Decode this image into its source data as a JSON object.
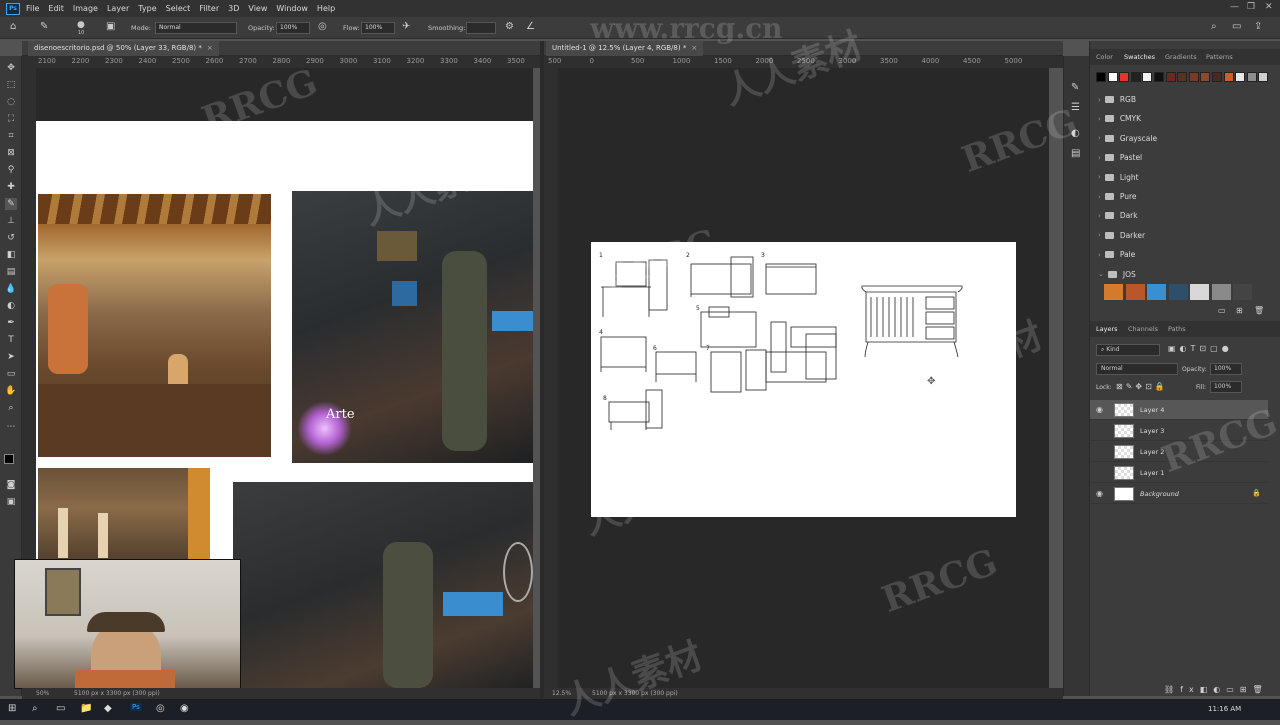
{
  "menu": [
    "File",
    "Edit",
    "Image",
    "Layer",
    "Type",
    "Select",
    "Filter",
    "3D",
    "View",
    "Window",
    "Help"
  ],
  "app_badge": "Ps",
  "options": {
    "mode_label": "Mode:",
    "mode_value": "Normal",
    "opacity_label": "Opacity:",
    "opacity_value": "100%",
    "flow_label": "Flow:",
    "flow_value": "100%",
    "smoothing_label": "Smoothing:",
    "brush_size": "10"
  },
  "doc_left": {
    "tab": "disenoescritorio.psd @ 50% (Layer 33, RGB/8) *",
    "zoom": "50%",
    "info": "5100 px x 3300 px (300 ppi)",
    "ruler": [
      "2100",
      "2200",
      "2300",
      "2400",
      "2500",
      "2600",
      "2700",
      "2800",
      "2900",
      "3000",
      "3100",
      "3200",
      "3300",
      "3400",
      "3500"
    ],
    "overlay_text": "Arte"
  },
  "doc_right": {
    "tab": "Untitled-1 @ 12.5% (Layer 4, RGB/8) *",
    "zoom": "12.5%",
    "info": "5100 px x 3300 px (300 ppi)",
    "ruler": [
      "500",
      "0",
      "500",
      "1000",
      "1500",
      "2000",
      "2500",
      "3000",
      "3500",
      "4000",
      "4500",
      "5000"
    ],
    "sketch_marks": [
      "1",
      "2",
      "3",
      "4",
      "5",
      "6",
      "7",
      "8"
    ]
  },
  "swatch_tabs": [
    "Color",
    "Swatches",
    "Gradients",
    "Patterns"
  ],
  "swatch_colors": [
    "#000000",
    "#ffffff",
    "#e03a2f",
    "#222222",
    "#f5f5f5",
    "#111111",
    "#6a2b1e",
    "#5a3020",
    "#7a3a28",
    "#8a4a30",
    "#4a2a20",
    "#c8622a",
    "#e8e8e8",
    "#8c8c8c",
    "#cfcfcf"
  ],
  "swatch_groups": [
    "RGB",
    "CMYK",
    "Grayscale",
    "Pastel",
    "Light",
    "Pure",
    "Dark",
    "Darker",
    "Pale",
    "JOS"
  ],
  "jos_colors": [
    "#d37a2c",
    "#b9572a",
    "#3a8fd0",
    "#2e4f6a",
    "#d8d8d8",
    "#8a8a8a",
    "#444444"
  ],
  "layer_tabs": [
    "Layers",
    "Channels",
    "Paths"
  ],
  "layers_controls": {
    "kind": "Kind",
    "blend": "Normal",
    "opacity_label": "Opacity:",
    "opacity_value": "100%",
    "lock_label": "Lock:",
    "fill_label": "Fill:",
    "fill_value": "100%"
  },
  "layers": [
    "Layer 4",
    "Layer 3",
    "Layer 2",
    "Layer 1",
    "Background"
  ],
  "taskbar": {
    "time": "11:16 AM"
  },
  "watermarks": [
    "www.rrcg.cn",
    "RRCG",
    "人人素材",
    "RRCG",
    "人人素材",
    "RRCG",
    "人人素材",
    "RRCG",
    "人人素材",
    "RRCG",
    "人人素材"
  ],
  "colors": {
    "ui_dark": "#323232",
    "ui_mid": "#3c3c3c",
    "canvas": "#282828",
    "accent": "#31a8ff"
  }
}
